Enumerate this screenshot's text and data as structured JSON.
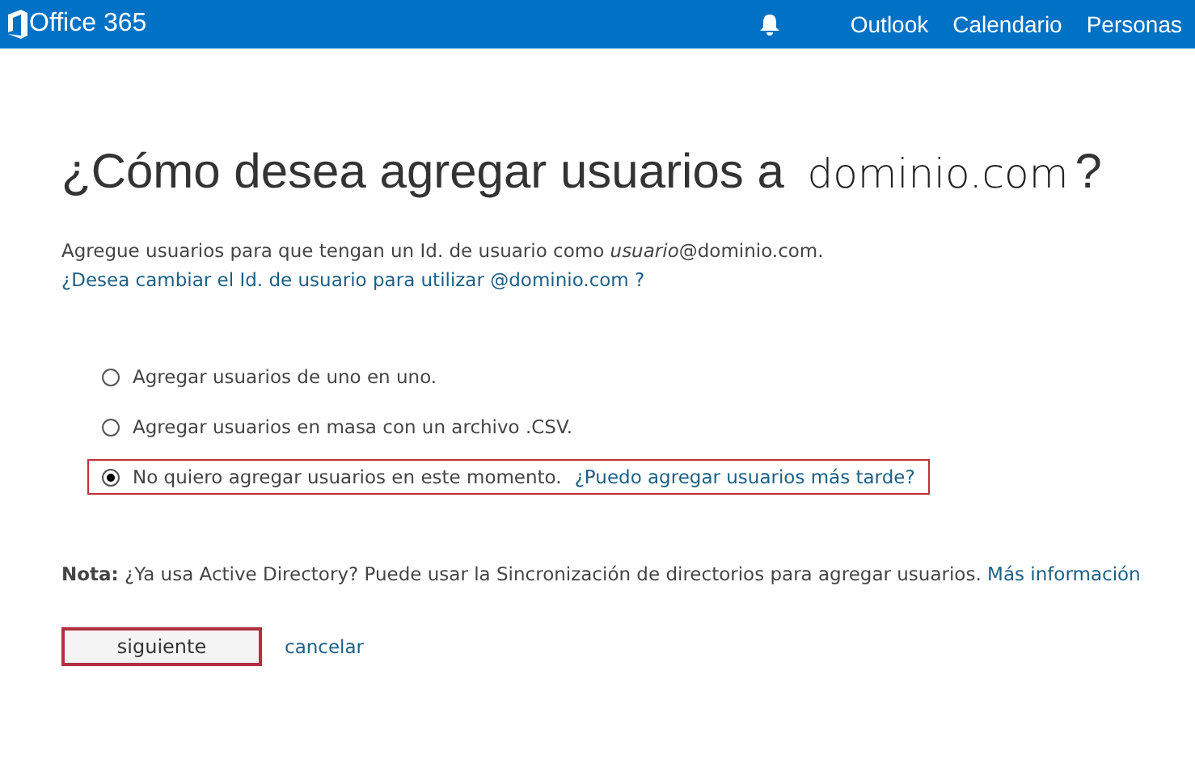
{
  "header": {
    "brand": "Office 365",
    "nav": [
      "Outlook",
      "Calendario",
      "Personas"
    ]
  },
  "title": {
    "text": "¿Cómo desea agregar usuarios a",
    "domain": "dominio.com",
    "end": "?"
  },
  "intro": {
    "text": "Agregue usuarios para que tengan un Id. de usuario como *usuario*@dominio.com.",
    "link": "¿Desea cambiar el Id. de usuario para utilizar @dominio.com ?"
  },
  "options": [
    {
      "label": "Agregar usuarios de uno en uno.",
      "selected": false,
      "highlighted": false
    },
    {
      "label": "Agregar usuarios en masa con un archivo .CSV.",
      "selected": false,
      "highlighted": false
    },
    {
      "label": "No quiero agregar usuarios en este momento.",
      "link": "¿Puedo agregar usuarios más tarde?",
      "selected": true,
      "highlighted": true
    }
  ],
  "note": {
    "text": "**Nota:** ¿Ya usa Active Directory? Puede usar la Sincronización de directorios para agregar usuarios.",
    "link": "Más información"
  },
  "actions": {
    "next": {
      "label": "siguiente",
      "highlighted": true
    },
    "cancel": "cancelar"
  }
}
